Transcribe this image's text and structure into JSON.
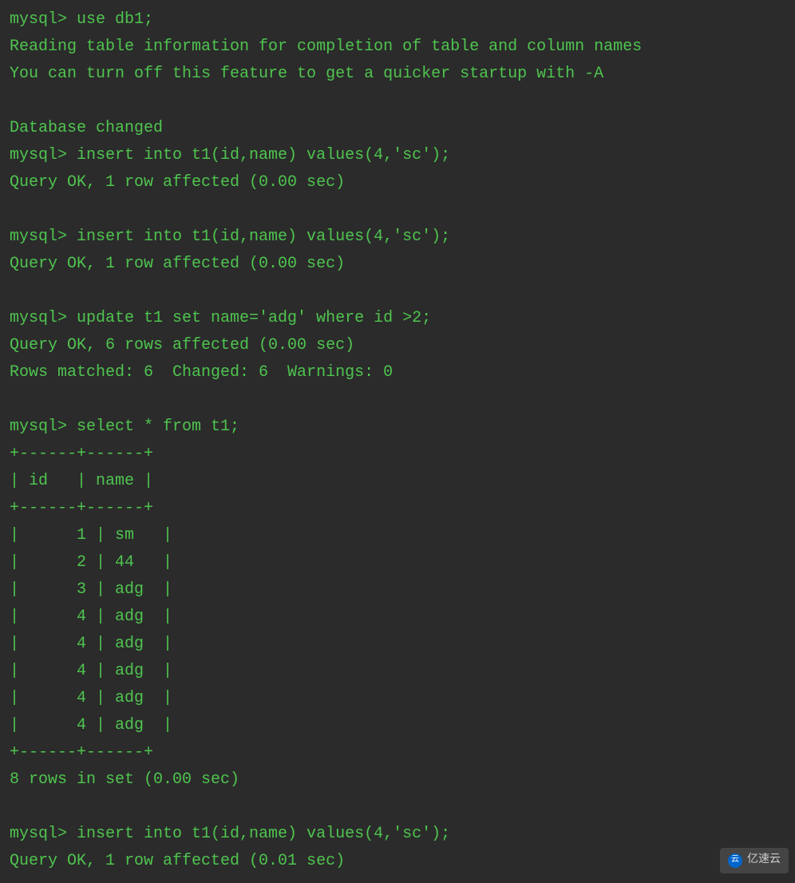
{
  "terminal": {
    "background": "#2b2b2b",
    "text_color": "#4fc44f",
    "lines": [
      "mysql> use db1;",
      "Reading table information for completion of table and column names",
      "You can turn off this feature to get a quicker startup with -A",
      "",
      "Database changed",
      "mysql> insert into t1(id,name) values(4,'sc');",
      "Query OK, 1 row affected (0.00 sec)",
      "",
      "mysql> insert into t1(id,name) values(4,'sc');",
      "Query OK, 1 row affected (0.00 sec)",
      "",
      "mysql> update t1 set name='adg' where id >2;",
      "Query OK, 6 rows affected (0.00 sec)",
      "Rows matched: 6  Changed: 6  Warnings: 0",
      "",
      "mysql> select * from t1;",
      "+------+------+",
      "| id   | name |",
      "+------+------+",
      "|      1 | sm   |",
      "|      2 | 44   |",
      "|      3 | adg  |",
      "|      4 | adg  |",
      "|      4 | adg  |",
      "|      4 | adg  |",
      "|      4 | adg  |",
      "|      4 | adg  |",
      "+------+------+",
      "8 rows in set (0.00 sec)",
      "",
      "mysql> insert into t1(id,name) values(4,'sc');",
      "Query OK, 1 row affected (0.01 sec)"
    ]
  },
  "watermark": {
    "text": "亿速云",
    "icon": "云"
  }
}
